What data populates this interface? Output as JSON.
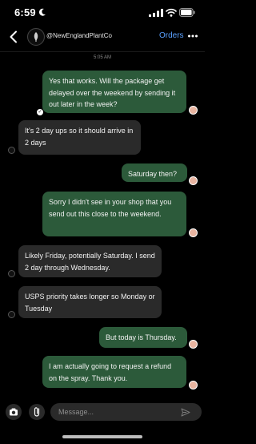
{
  "status_bar": {
    "time": "6:59"
  },
  "header": {
    "shop_name": "@NewEnglandPlantCo",
    "orders_label": "Orders"
  },
  "thread": {
    "timestamp": "5:05 AM",
    "messages": [
      {
        "from": "me",
        "text": "Yes that works. Will the package get delayed over the weekend by sending it out later in the week?"
      },
      {
        "from": "shop",
        "text": "It's 2 day ups so it should arrive in 2 days"
      },
      {
        "from": "me",
        "text": "Saturday then?"
      },
      {
        "from": "shop",
        "text": "Sorry I didn't see in your shop that you send out this close to the weekend."
      },
      {
        "from": "shop",
        "text": "Likely Friday, potentially Saturday. I send 2 day through Wednesday."
      },
      {
        "from": "shop",
        "text": "USPS priority takes longer so Monday or Tuesday"
      },
      {
        "from": "me",
        "text": "But today is Thursday."
      },
      {
        "from": "me",
        "text": "I am actually going to request a refund on the spray. Thank you."
      }
    ]
  },
  "composer": {
    "placeholder": "Message..."
  },
  "colors": {
    "sent_bubble": "#2c5a3a",
    "received_bubble": "#2a2a2a",
    "link": "#5aa0ff",
    "background": "#000000"
  },
  "icons": [
    "moon-icon",
    "signal-icon",
    "wifi-icon",
    "battery-icon",
    "back-arrow-icon",
    "more-icon",
    "camera-icon",
    "paperclip-icon",
    "send-icon"
  ]
}
